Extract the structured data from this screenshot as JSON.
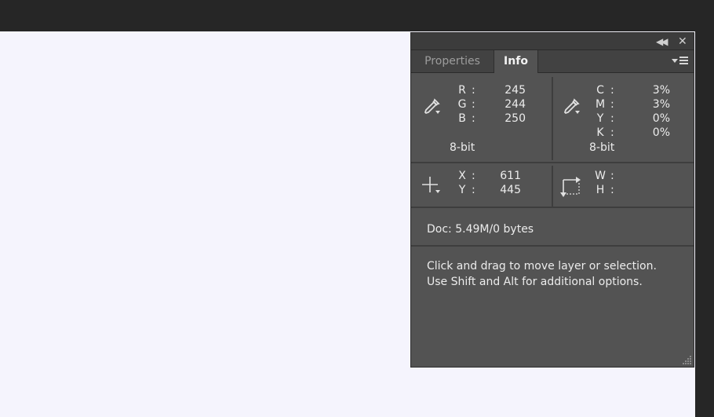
{
  "panel": {
    "tabs": [
      {
        "label": "Properties",
        "active": false
      },
      {
        "label": "Info",
        "active": true
      }
    ],
    "header_icons": {
      "collapse": "double-chevron-left-icon",
      "close": "close-icon",
      "menu": "panel-menu-icon"
    }
  },
  "rgb": {
    "rows": [
      {
        "label": "R",
        "value": "245"
      },
      {
        "label": "G",
        "value": "244"
      },
      {
        "label": "B",
        "value": "250"
      }
    ],
    "bit_depth": "8-bit"
  },
  "cmyk": {
    "rows": [
      {
        "label": "C",
        "value": "3%"
      },
      {
        "label": "M",
        "value": "3%"
      },
      {
        "label": "Y",
        "value": "0%"
      },
      {
        "label": "K",
        "value": "0%"
      }
    ],
    "bit_depth": "8-bit"
  },
  "position": {
    "x_label": "X",
    "x_value": "611",
    "y_label": "Y",
    "y_value": "445"
  },
  "size": {
    "w_label": "W",
    "w_value": "",
    "h_label": "H",
    "h_value": ""
  },
  "doc": {
    "text": "Doc: 5.49M/0 bytes"
  },
  "help": {
    "line1": "Click and drag to move layer or selection.",
    "line2": "Use Shift and Alt for additional options."
  },
  "colors": {
    "panel_bg": "#535353",
    "canvas_bg": "#f5f4fd",
    "app_bg": "#262626"
  }
}
